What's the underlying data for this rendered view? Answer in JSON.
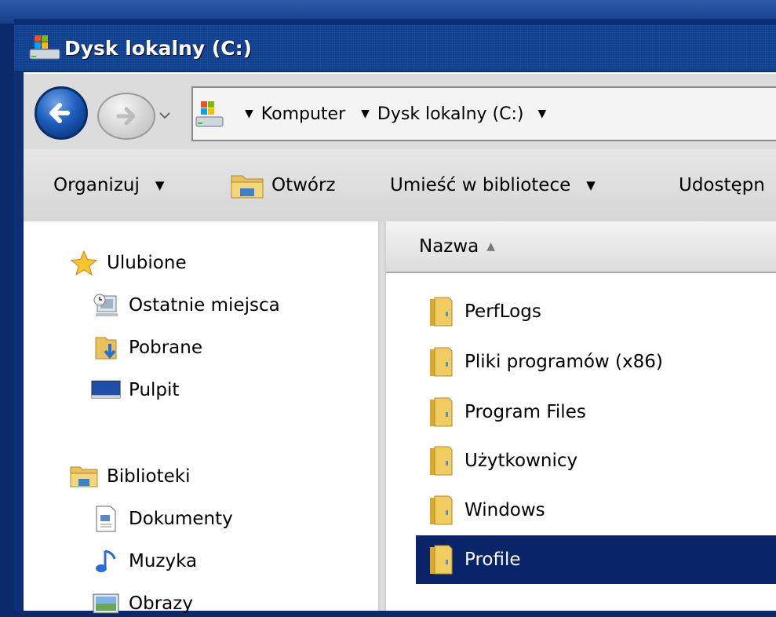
{
  "window": {
    "title": "Dysk lokalny (C:)"
  },
  "address_bar": {
    "breadcrumbs": [
      "Komputer",
      "Dysk lokalny (C:)"
    ]
  },
  "toolbar": {
    "organize_label": "Organizuj",
    "open_label": "Otwórz",
    "library_label": "Umieść w bibliotece",
    "share_label": "Udostępn"
  },
  "nav": {
    "favorites": {
      "label": "Ulubione",
      "items": [
        {
          "label": "Ostatnie miejsca",
          "icon": "recent-places-icon"
        },
        {
          "label": "Pobrane",
          "icon": "downloads-icon"
        },
        {
          "label": "Pulpit",
          "icon": "desktop-icon"
        }
      ]
    },
    "libraries": {
      "label": "Biblioteki",
      "items": [
        {
          "label": "Dokumenty",
          "icon": "documents-icon"
        },
        {
          "label": "Muzyka",
          "icon": "music-icon"
        },
        {
          "label": "Obrazy",
          "icon": "pictures-icon"
        }
      ]
    }
  },
  "files": {
    "column_name": "Nazwa",
    "items": [
      {
        "name": "PerfLogs",
        "selected": false
      },
      {
        "name": "Pliki programów (x86)",
        "selected": false
      },
      {
        "name": "Program Files",
        "selected": false
      },
      {
        "name": "Użytkownicy",
        "selected": false
      },
      {
        "name": "Windows",
        "selected": false
      },
      {
        "name": "Profile",
        "selected": true
      }
    ]
  },
  "colors": {
    "title_bar": "#0c3d8e",
    "selection": "#0a246a",
    "desktop": "#0b2a6b"
  }
}
